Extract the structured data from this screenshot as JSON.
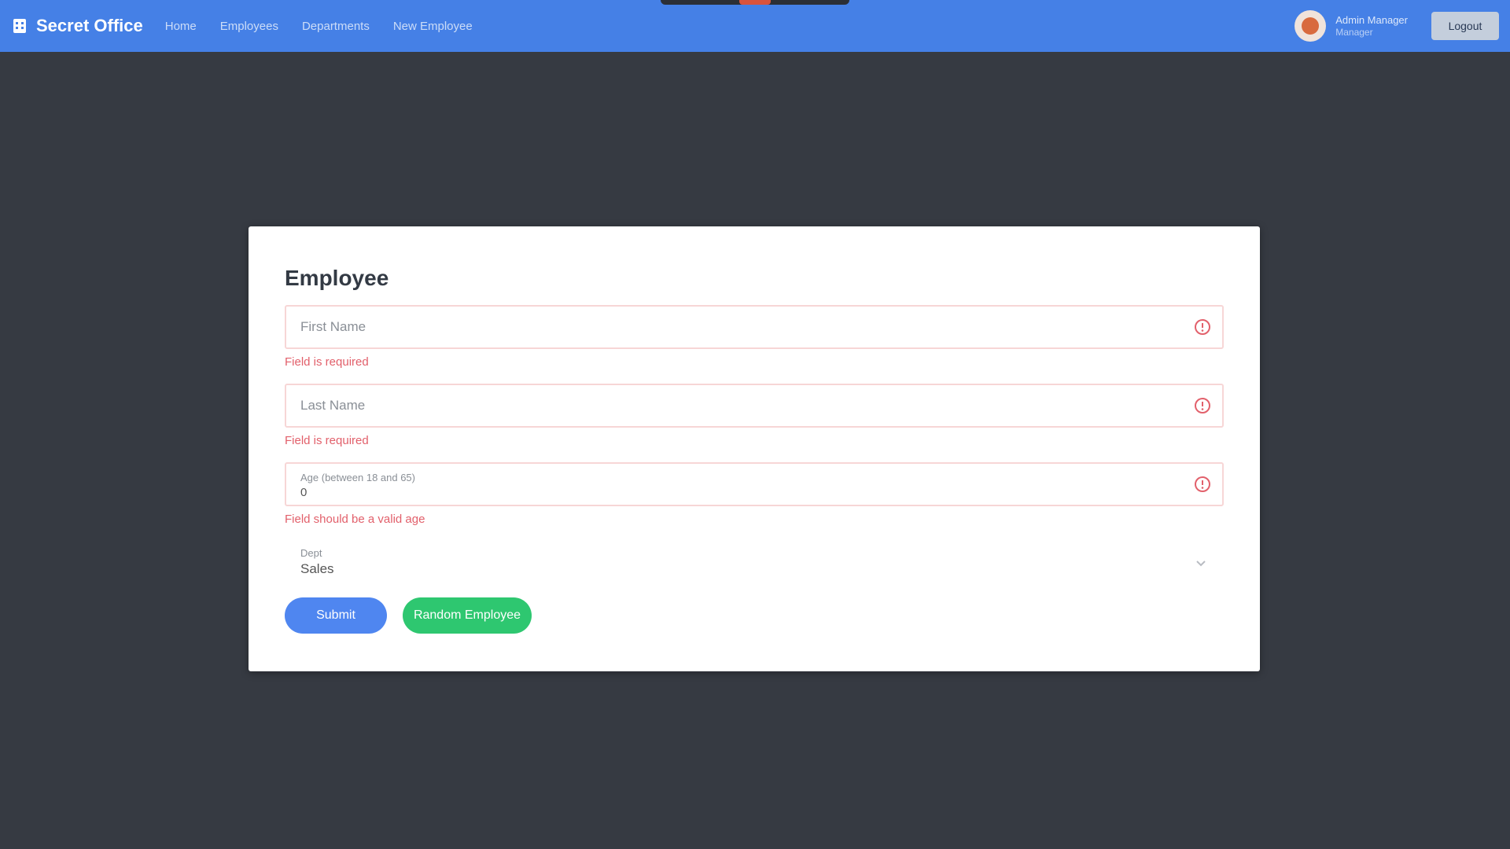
{
  "app": {
    "brand_name": "Secret Office"
  },
  "nav": {
    "items": [
      {
        "label": "Home"
      },
      {
        "label": "Employees"
      },
      {
        "label": "Departments"
      },
      {
        "label": "New Employee"
      }
    ]
  },
  "user": {
    "name": "Admin Manager",
    "role": "Manager",
    "logout_label": "Logout"
  },
  "form": {
    "title": "Employee",
    "fields": [
      {
        "placeholder": "First Name",
        "value": "",
        "error": "Field is required"
      },
      {
        "placeholder": "Last Name",
        "value": "",
        "error": "Field is required"
      },
      {
        "label": "Age (between 18 and 65)",
        "value": "0",
        "error": "Field should be a valid age"
      }
    ],
    "select": {
      "label": "Dept",
      "value": "Sales"
    },
    "submit_label": "Submit",
    "secondary_label": "Random Employee"
  },
  "colors": {
    "topbar": "#4580e6",
    "background": "#363a42",
    "error": "#e2606b",
    "primary_button": "#4f86f0",
    "success_button": "#2ec770"
  }
}
